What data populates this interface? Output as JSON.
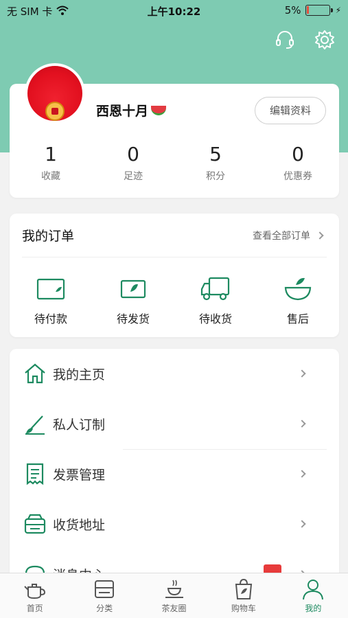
{
  "status_bar": {
    "carrier": "无 SIM 卡",
    "time": "上午10:22",
    "battery": "5%"
  },
  "header": {
    "icons": [
      "headset-icon",
      "gear-icon"
    ]
  },
  "profile": {
    "nickname": "西恩十月",
    "edit_label": "编辑资料"
  },
  "stats": [
    {
      "value": "1",
      "label": "收藏"
    },
    {
      "value": "0",
      "label": "足迹"
    },
    {
      "value": "5",
      "label": "积分"
    },
    {
      "value": "0",
      "label": "优惠券"
    }
  ],
  "orders": {
    "title": "我的订单",
    "view_all": "查看全部订单",
    "items": [
      {
        "label": "待付款",
        "icon": "wallet-icon"
      },
      {
        "label": "待发货",
        "icon": "package-icon"
      },
      {
        "label": "待收货",
        "icon": "truck-icon"
      },
      {
        "label": "售后",
        "icon": "tea-bowl-icon"
      }
    ]
  },
  "menu": [
    {
      "label": "我的主页",
      "icon": "home-icon"
    },
    {
      "label": "私人订制",
      "icon": "brush-icon"
    },
    {
      "label": "发票管理",
      "icon": "invoice-icon"
    },
    {
      "label": "收货地址",
      "icon": "address-box-icon"
    },
    {
      "label": "消息中心",
      "icon": "message-icon"
    }
  ],
  "tabbar": [
    {
      "label": "首页",
      "icon": "teapot-icon"
    },
    {
      "label": "分类",
      "icon": "category-icon"
    },
    {
      "label": "茶友圈",
      "icon": "tea-cup-icon"
    },
    {
      "label": "购物车",
      "icon": "shopping-bag-icon"
    },
    {
      "label": "我的",
      "icon": "user-icon",
      "active": true
    }
  ],
  "colors": {
    "brand": "#7ecbb2",
    "accent": "#1d8a60",
    "badge": "#e73b3b"
  }
}
